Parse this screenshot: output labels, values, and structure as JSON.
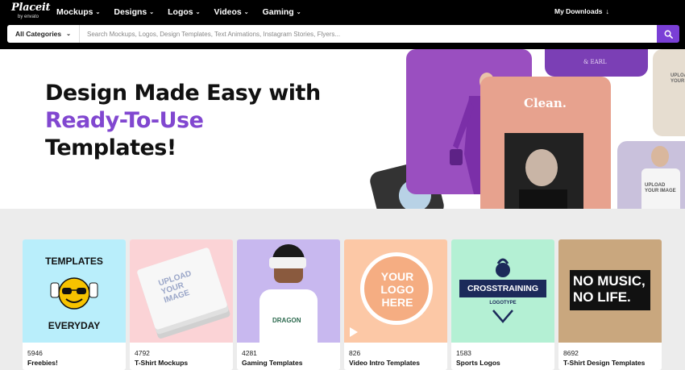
{
  "logo": {
    "main": "Placeit",
    "sub": "by envato"
  },
  "nav": {
    "items": [
      {
        "label": "Mockups"
      },
      {
        "label": "Designs"
      },
      {
        "label": "Logos"
      },
      {
        "label": "Videos"
      },
      {
        "label": "Gaming"
      }
    ],
    "downloads": "My Downloads"
  },
  "search": {
    "category": "All Categories",
    "placeholder": "Search Mockups, Logos, Design Templates, Text Animations, Instagram Stories, Flyers..."
  },
  "hero": {
    "line1": "Design Made Easy with",
    "line2": "Ready-To-Use",
    "line3": "Templates!",
    "collage": {
      "clean_text": "Clean.",
      "earl_text": "& EARL",
      "mug_text": "UPLOAD YOUR IMAGE",
      "tank_text": "UPLOAD YOUR IMAGE"
    }
  },
  "categories": [
    {
      "count": "5946",
      "label": "Freebies!",
      "bg": "#b9eefb",
      "art_top": "TEMPLATES",
      "art_bottom": "EVERYDAY"
    },
    {
      "count": "4792",
      "label": "T-Shirt Mockups",
      "bg": "#fbd3d6",
      "art_text": "UPLOAD YOUR IMAGE"
    },
    {
      "count": "4281",
      "label": "Gaming Templates",
      "bg": "#c8b8ef",
      "art_text": "DRAGON"
    },
    {
      "count": "826",
      "label": "Video Intro Templates",
      "bg": "#fcc8a6",
      "art_text": "YOUR LOGO HERE"
    },
    {
      "count": "1583",
      "label": "Sports Logos",
      "bg": "#b4f0d4",
      "art_text": "CROSSTRAINING",
      "art_sub": "LOGOTYPE"
    },
    {
      "count": "8692",
      "label": "T-Shirt Design Templates",
      "bg": "#c9a77e",
      "art_text": "NO MUSIC, NO LIFE."
    }
  ]
}
